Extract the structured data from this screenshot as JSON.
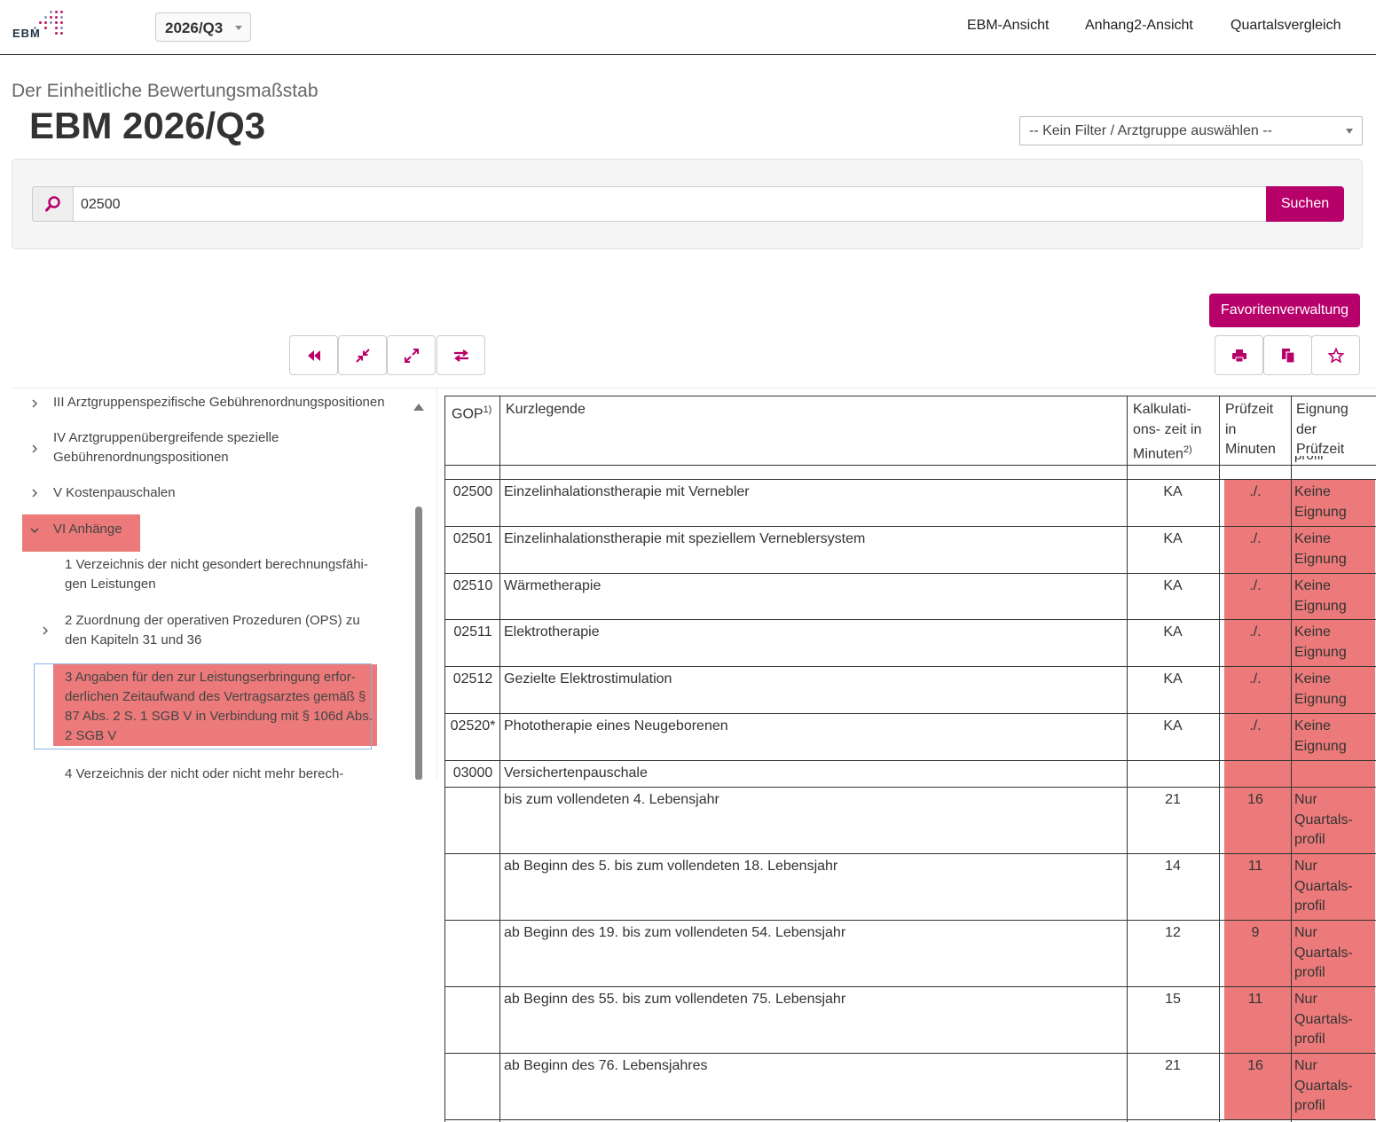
{
  "header": {
    "logo_text": "EBM",
    "quarter": "2026/Q3",
    "nav": [
      "EBM-Ansicht",
      "Anhang2-Ansicht",
      "Quartalsvergleich"
    ]
  },
  "page": {
    "subtitle": "Der Einheitliche Bewertungsmaßstab",
    "title": "EBM 2026/Q3",
    "filter_placeholder": "-- Kein Filter / Arztgruppe auswählen --"
  },
  "search": {
    "value": "02500",
    "button": "Suchen"
  },
  "toolbar": {
    "favorites": "Favoritenverwaltung",
    "left_icons": [
      "fast-backward-icon",
      "collapse-icon",
      "expand-icon",
      "swap-icon"
    ],
    "right_icons": [
      "print-icon",
      "copy-icon",
      "star-icon"
    ]
  },
  "tree": {
    "items": [
      {
        "label": "III Arztgruppenspezifische Gebührenordnungspositionen",
        "lines": [
          "III Arztgruppenspezifische Gebührenordnungspositionen"
        ]
      },
      {
        "label": "IV Arztgruppenübergreifende spezielle Gebührenordnungspositionen",
        "lines": [
          "IV Arztgruppenübergreifende spezielle",
          "Gebührenordnungspositionen"
        ]
      },
      {
        "label": "V Kostenpauschalen",
        "lines": [
          "V Kostenpauschalen"
        ]
      },
      {
        "label": "VI Anhänge",
        "lines": [
          "VI Anhänge"
        ]
      },
      {
        "label": "1 Verzeichnis der nicht gesondert berechnungsfähigen Leistungen",
        "lines": [
          "1 Verzeichnis der nicht gesondert berechnungsfähi-",
          "gen Leistungen"
        ]
      },
      {
        "label": "2 Zuordnung der operativen Prozeduren (OPS) zu den Kapiteln 31 und 36",
        "lines": [
          "2 Zuordnung der operativen Prozeduren (OPS) zu",
          "den Kapiteln 31 und 36"
        ]
      },
      {
        "label": "3 Angaben für den zur Leistungserbringung erforderlichen Zeitaufwand des Vertragsarztes gemäß § 87 Abs. 2 S. 1 SGB V in Verbindung mit § 106d Abs. 2 SGB V",
        "lines": [
          "3 Angaben für den zur Leistungserbringung erfor-",
          "derlichen Zeitaufwand des Vertragsarztes gemäß §",
          "87 Abs. 2 S. 1 SGB V in Verbindung mit § 106d Abs.",
          "2 SGB V"
        ]
      },
      {
        "label": "4 Verzeichnis der nicht oder nicht mehr berech-",
        "lines": [
          "4 Verzeichnis der nicht oder nicht mehr berech-"
        ]
      }
    ]
  },
  "table": {
    "headers": {
      "gop": "GOP",
      "gop_sup": "1)",
      "kurz": "Kurzlegende",
      "kalk_lines": [
        "Kalkulati-",
        "ons- zeit in",
        "Minuten"
      ],
      "kalk_sup": "2)",
      "pruef_lines": [
        "Prüfzeit",
        "in",
        "Minuten"
      ],
      "eign_lines": [
        "Eignung",
        "der",
        "Prüfzeit"
      ],
      "cut_text": "profil"
    },
    "rows": [
      {
        "gop": "02500",
        "kurz": "Einzelinhalationstherapie mit Vernebler",
        "kalk": "KA",
        "pruef": "./.",
        "eign": [
          "Keine",
          "Eignung"
        ]
      },
      {
        "gop": "02501",
        "kurz": "Einzelinhalationstherapie mit speziellem Verneblersystem",
        "kalk": "KA",
        "pruef": "./.",
        "eign": [
          "Keine",
          "Eignung"
        ]
      },
      {
        "gop": "02510",
        "kurz": "Wärmetherapie",
        "kalk": "KA",
        "pruef": "./.",
        "eign": [
          "Keine",
          "Eignung"
        ]
      },
      {
        "gop": "02511",
        "kurz": "Elektrotherapie",
        "kalk": "KA",
        "pruef": "./.",
        "eign": [
          "Keine",
          "Eignung"
        ]
      },
      {
        "gop": "02512",
        "kurz": "Gezielte Elektrostimulation",
        "kalk": "KA",
        "pruef": "./.",
        "eign": [
          "Keine",
          "Eignung"
        ]
      },
      {
        "gop": "02520*",
        "kurz": "Phototherapie eines Neugeborenen",
        "kalk": "KA",
        "pruef": "./.",
        "eign": [
          "Keine",
          "Eignung"
        ]
      },
      {
        "gop": "03000",
        "kurz": "Versichertenpauschale",
        "kalk": "",
        "pruef": "",
        "eign": []
      },
      {
        "gop": "",
        "kurz": "bis zum vollendeten 4. Lebensjahr",
        "kalk": "21",
        "pruef": "16",
        "eign": [
          "Nur",
          "Quartals-",
          "profil"
        ]
      },
      {
        "gop": "",
        "kurz": "ab Beginn des 5. bis zum vollendeten 18. Lebensjahr",
        "kalk": "14",
        "pruef": "11",
        "eign": [
          "Nur",
          "Quartals-",
          "profil"
        ]
      },
      {
        "gop": "",
        "kurz": "ab Beginn des 19. bis zum vollendeten 54. Lebensjahr",
        "kalk": "12",
        "pruef": "9",
        "eign": [
          "Nur",
          "Quartals-",
          "profil"
        ]
      },
      {
        "gop": "",
        "kurz": "ab Beginn des 55. bis zum vollendeten 75. Lebensjahr",
        "kalk": "15",
        "pruef": "11",
        "eign": [
          "Nur",
          "Quartals-",
          "profil"
        ]
      },
      {
        "gop": "",
        "kurz": "ab Beginn des 76. Lebensjahres",
        "kalk": "21",
        "pruef": "16",
        "eign": [
          "Nur",
          "Quartals-",
          "profil"
        ]
      }
    ]
  },
  "colors": {
    "accent": "#b8006b",
    "highlight": "#ec7a7a"
  }
}
